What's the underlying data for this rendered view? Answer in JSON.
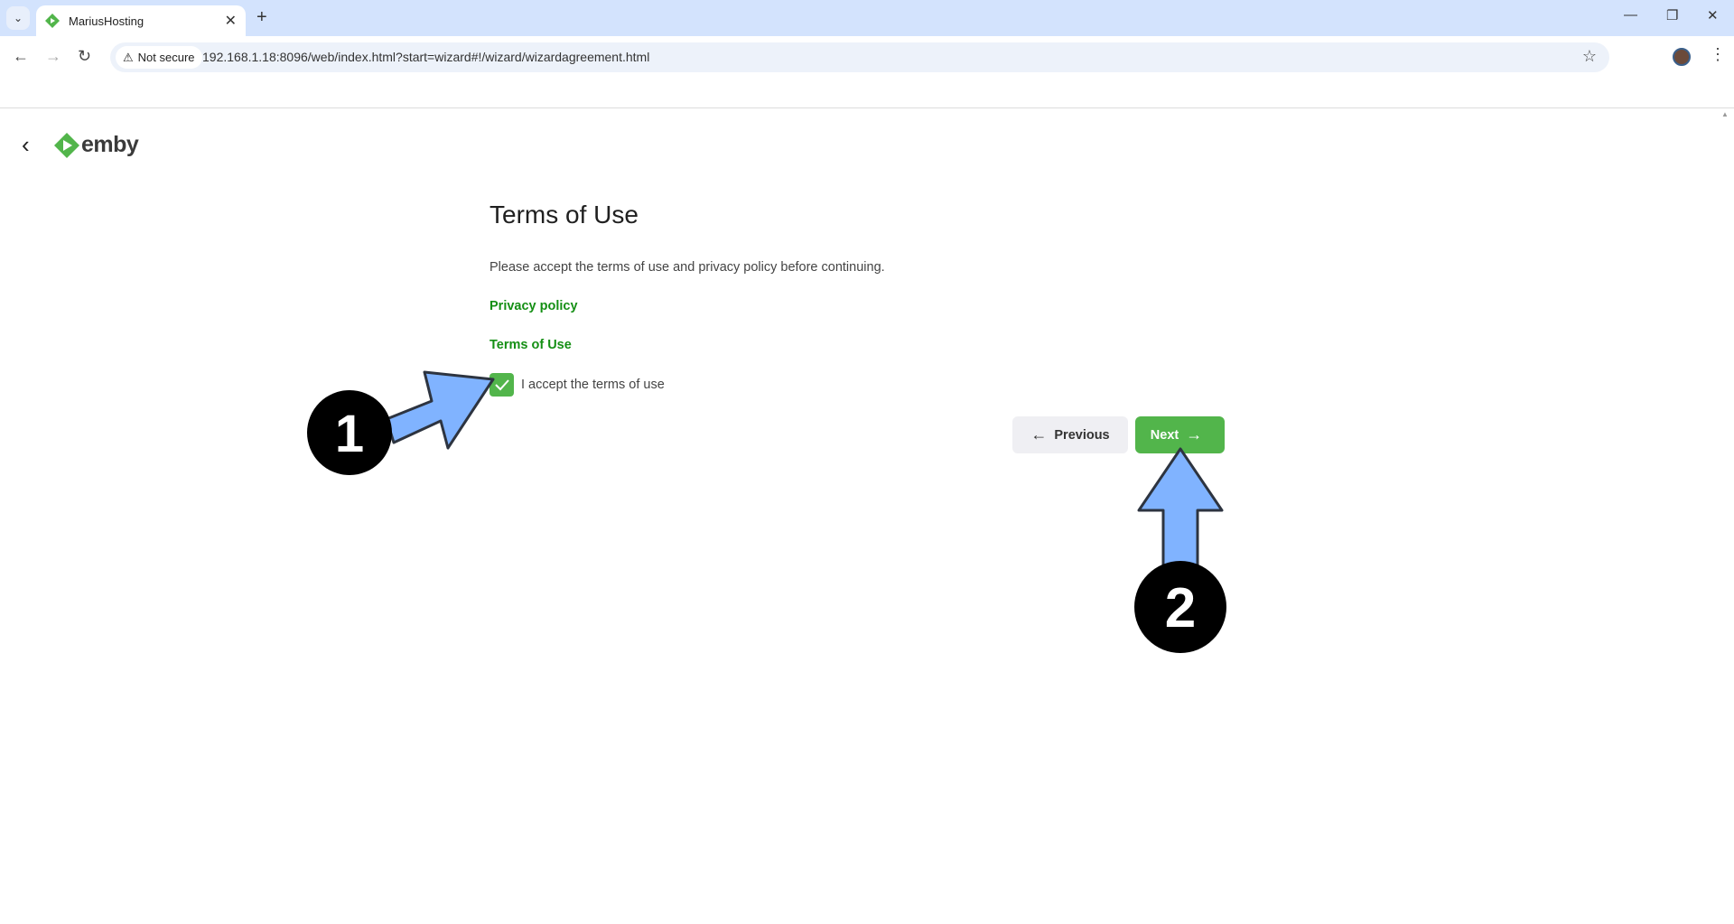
{
  "browser": {
    "tab_title": "MariusHosting",
    "security_label": "Not secure",
    "url": "192.168.1.18:8096/web/index.html?start=wizard#!/wizard/wizardagreement.html"
  },
  "app": {
    "logo_text": "emby",
    "brand_color": "#52b54b"
  },
  "page": {
    "title": "Terms of Use",
    "description": "Please accept the terms of use and privacy policy before continuing.",
    "privacy_link": "Privacy policy",
    "terms_link": "Terms of Use",
    "accept_label": "I accept the terms of use",
    "accept_checked": true,
    "previous_label": "Previous",
    "next_label": "Next"
  },
  "annotations": {
    "step1": "1",
    "step2": "2",
    "arrow_color": "#80b3ff"
  }
}
